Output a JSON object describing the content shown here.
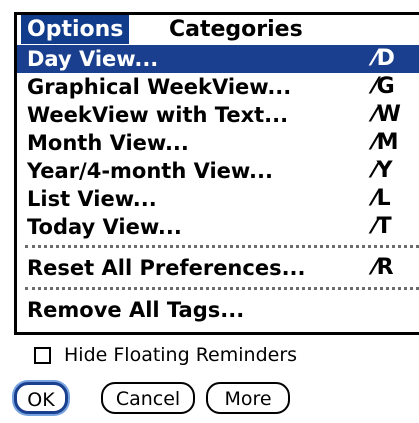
{
  "menubar": {
    "menus": [
      {
        "label": "Options"
      },
      {
        "label": "Categories"
      }
    ]
  },
  "dropdown": {
    "items": [
      {
        "label": "Day View...",
        "shortcut": "⁄D"
      },
      {
        "label": "Graphical WeekView...",
        "shortcut": "⁄G"
      },
      {
        "label": "WeekView with Text...",
        "shortcut": "⁄W"
      },
      {
        "label": "Month View...",
        "shortcut": "⁄M"
      },
      {
        "label": "Year/4-month View...",
        "shortcut": "⁄Y"
      },
      {
        "label": "List View...",
        "shortcut": "⁄L"
      },
      {
        "label": "Today View...",
        "shortcut": "⁄T"
      },
      {
        "label": "Reset All Preferences...",
        "shortcut": "⁄R"
      },
      {
        "label": "Remove All Tags...",
        "shortcut": ""
      }
    ]
  },
  "dialog": {
    "checkbox_label": "Hide Floating Reminders",
    "buttons": {
      "ok": "OK",
      "cancel": "Cancel",
      "more": "More"
    }
  },
  "colors": {
    "selection": "#1a3f8e",
    "ok_focus_ring": "#76a3e0"
  }
}
